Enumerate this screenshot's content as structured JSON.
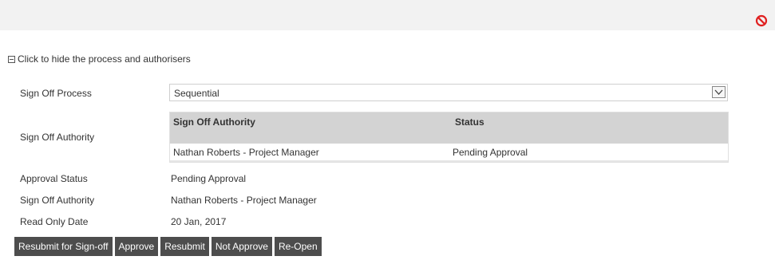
{
  "header": {
    "close_icon": "no-entry-icon",
    "close_color": "#e02020"
  },
  "toggle": {
    "label": "Click to hide the process and authorisers"
  },
  "form": {
    "sign_off_process_label": "Sign Off Process",
    "sign_off_process_value": "Sequential",
    "sign_off_authority_label": "Sign Off Authority",
    "approval_status_label": "Approval Status",
    "approval_status_value": "Pending Approval",
    "sign_off_authority2_label": "Sign Off Authority",
    "sign_off_authority2_value": "Nathan Roberts - Project Manager",
    "read_only_date_label": "Read Only Date",
    "read_only_date_value": "20 Jan, 2017"
  },
  "authority_table": {
    "columns": [
      "Sign Off Authority",
      "Status"
    ],
    "rows": [
      {
        "authority": "Nathan Roberts - Project Manager",
        "status": "Pending Approval"
      }
    ]
  },
  "actions": {
    "resubmit_signoff": "Resubmit for Sign-off",
    "approve": "Approve",
    "resubmit": "Resubmit",
    "not_approve": "Not Approve",
    "reopen": "Re-Open"
  }
}
